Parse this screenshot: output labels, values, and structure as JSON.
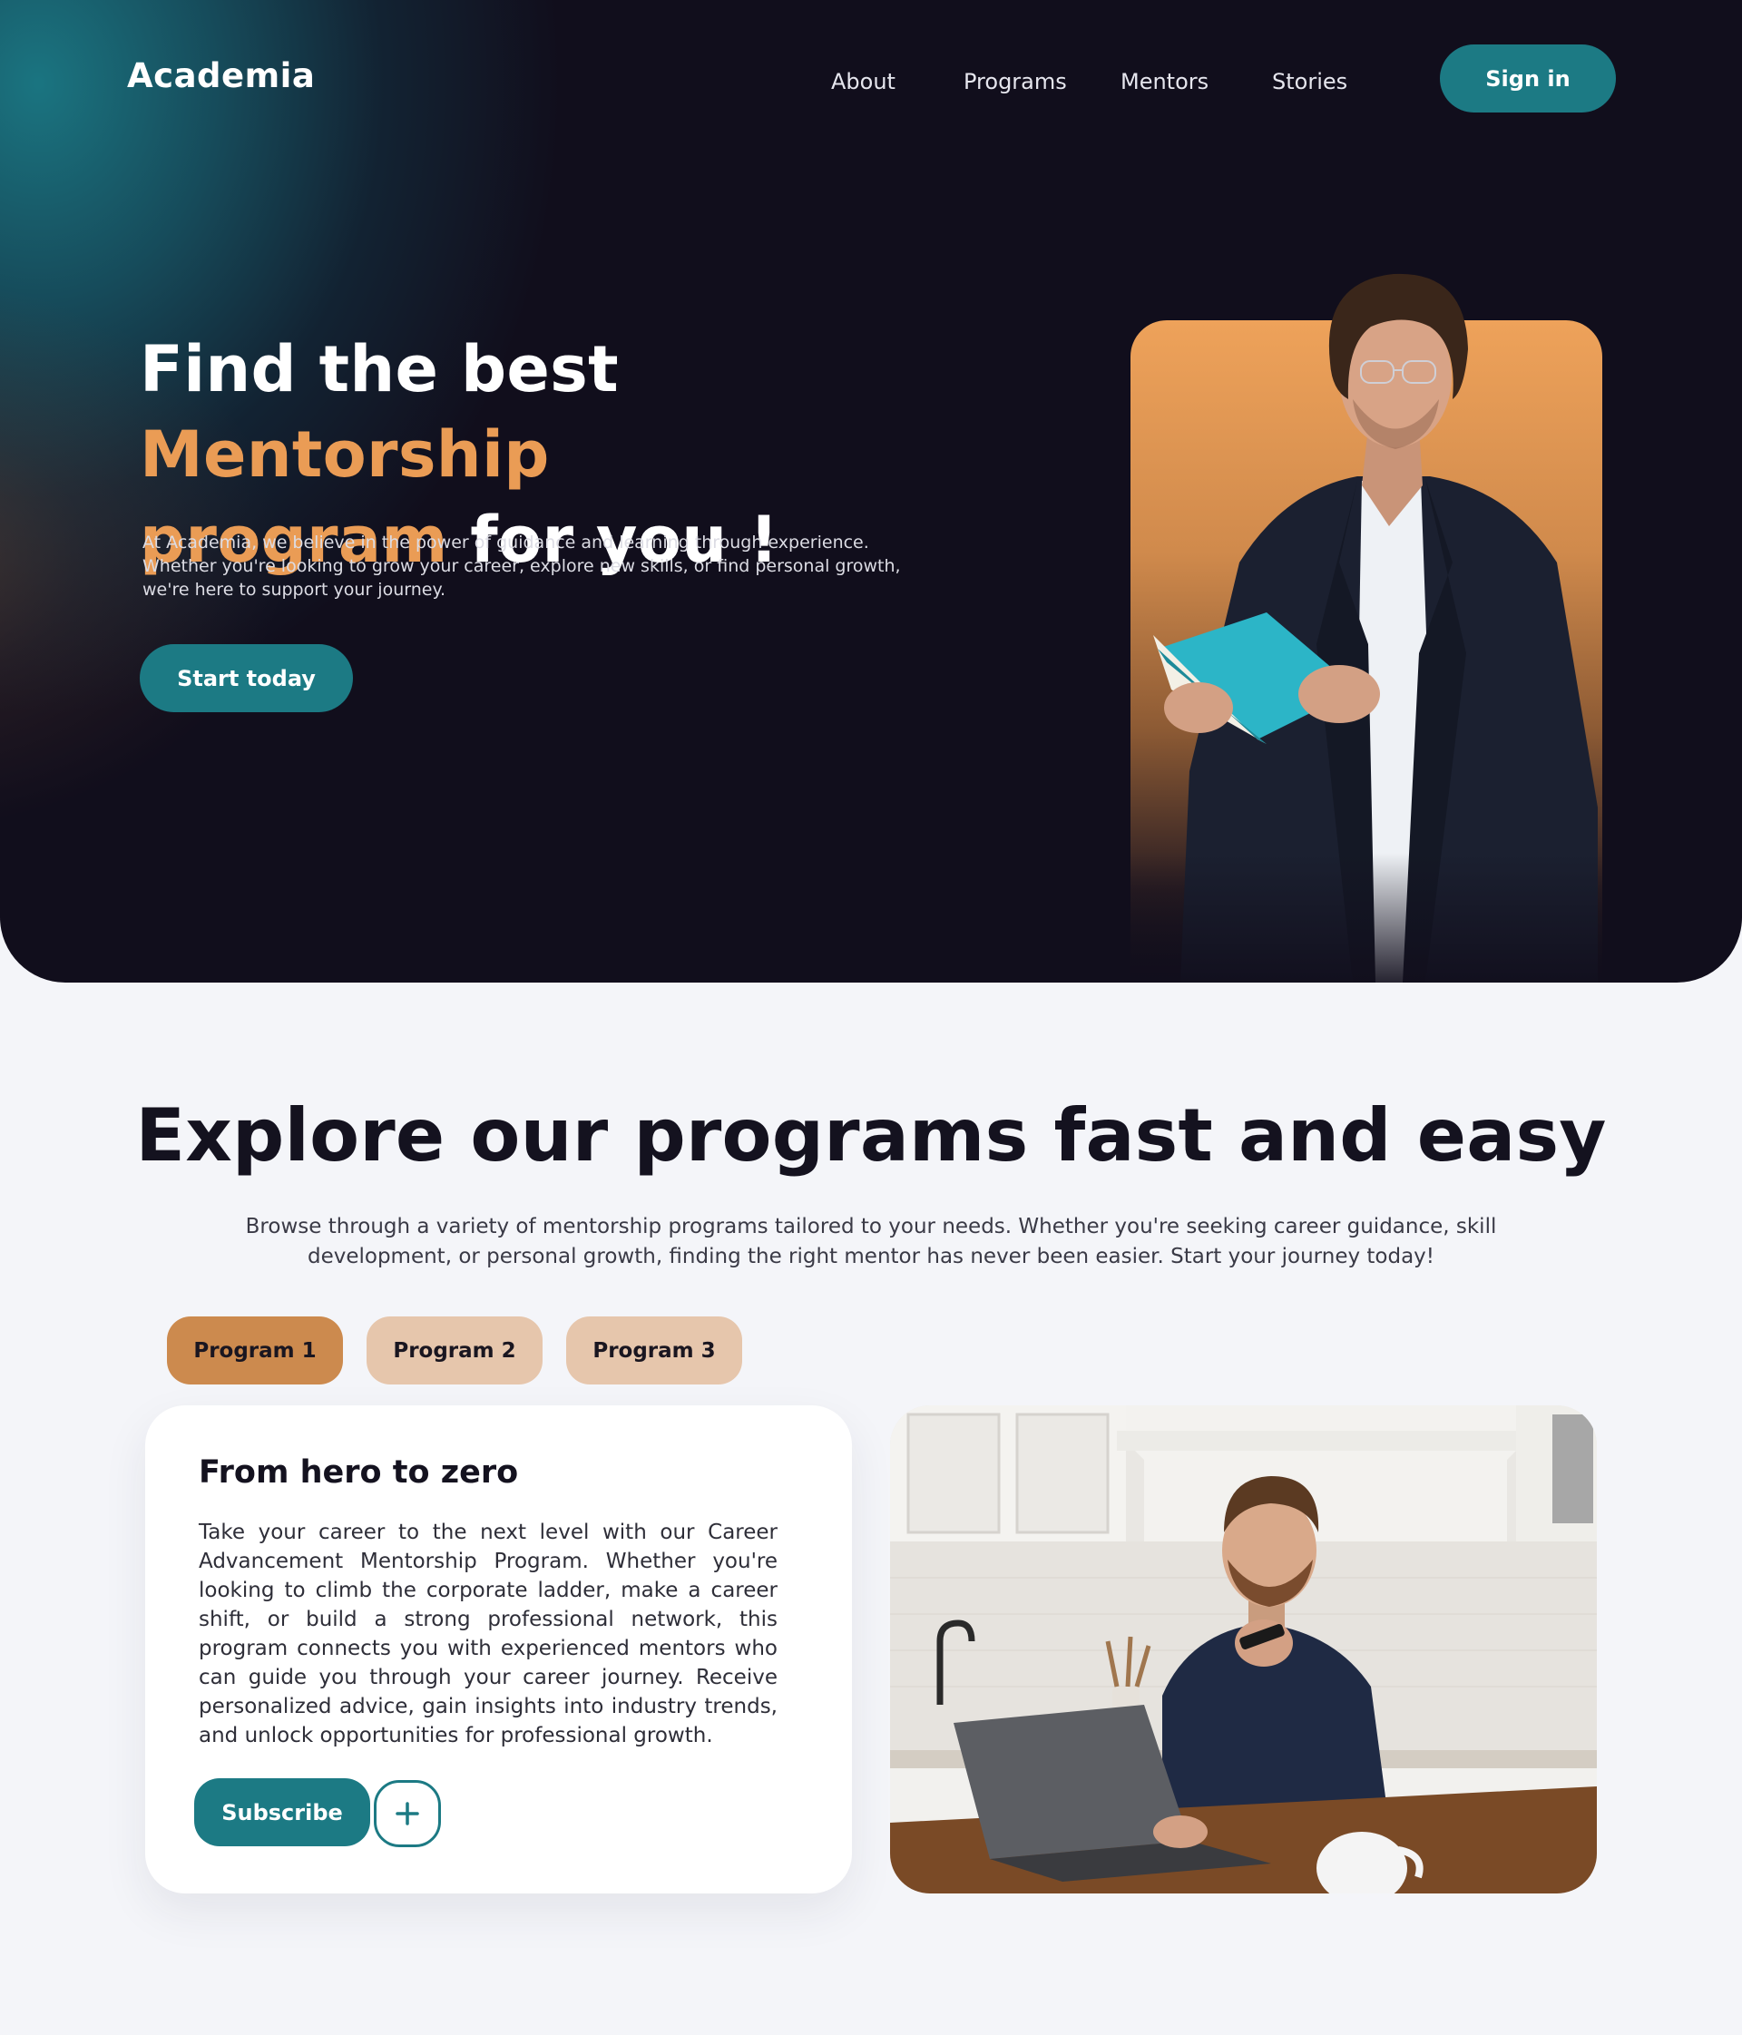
{
  "header": {
    "logo": "Academia",
    "nav": [
      {
        "label": "About"
      },
      {
        "label": "Programs"
      },
      {
        "label": "Mentors"
      },
      {
        "label": "Stories"
      }
    ],
    "signin_label": "Sign in"
  },
  "hero": {
    "title_part1": "Find the best ",
    "title_accent1": "Mentorship",
    "title_accent2": "program",
    "title_part2": " for you !",
    "description": "At Academia, we believe in the power of guidance and learning through experience. Whether you're looking to grow your career, explore new skills, or find personal growth, we're here to support your journey.",
    "cta_label": "Start today"
  },
  "programs": {
    "title": "Explore our programs fast and easy",
    "description": "Browse through a variety of mentorship programs tailored to your needs. Whether you're seeking career guidance, skill development, or personal growth, finding the right mentor has never been easier. Start your journey today!",
    "tabs": [
      {
        "label": "Program 1",
        "active": true
      },
      {
        "label": "Program 2",
        "active": false
      },
      {
        "label": "Program 3",
        "active": false
      }
    ],
    "card": {
      "title": "From hero to zero",
      "text": "Take your career to the next level with our Career Advancement Mentorship Program. Whether you're looking to climb the corporate ladder, make a career shift, or build a strong professional network, this program connects you with experienced mentors who can guide you through your career journey. Receive personalized advice, gain insights into industry trends, and unlock opportunities for professional growth.",
      "subscribe_label": "Subscribe"
    }
  },
  "colors": {
    "teal": "#1c7a84",
    "orange_accent": "#ea9c55",
    "hero_bg": "#110e1c",
    "tab_active": "#cc8a4e",
    "tab_inactive": "#e6c6ac"
  },
  "icons": {
    "add": "plus-icon"
  }
}
